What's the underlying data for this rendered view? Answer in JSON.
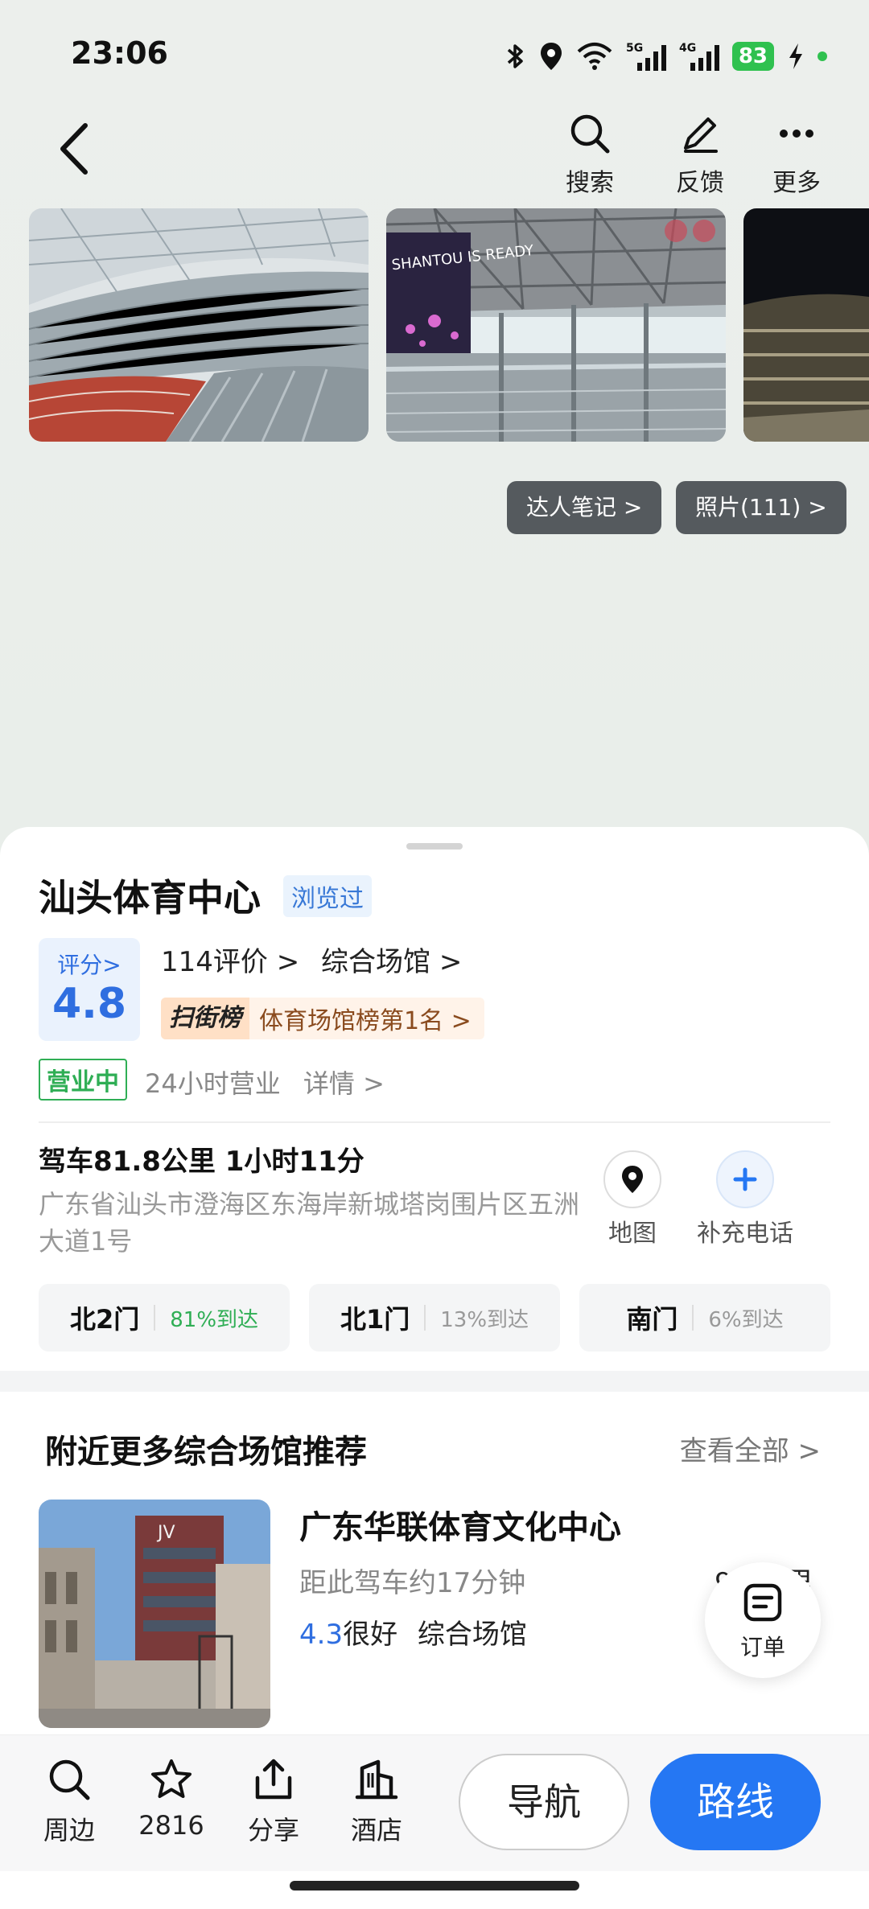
{
  "status_bar": {
    "time": "23:06",
    "battery": "83",
    "network_1": "5G",
    "network_2": "4G"
  },
  "header": {
    "actions": [
      {
        "label": "搜索",
        "icon": "search-icon"
      },
      {
        "label": "反馈",
        "icon": "edit-icon"
      },
      {
        "label": "更多",
        "icon": "more-icon"
      }
    ]
  },
  "gallery": {
    "chips": [
      "达人笔记 >",
      "照片(111) >"
    ],
    "photo2_text": "SHANTOU IS READY"
  },
  "place": {
    "title": "汕头体育中心",
    "browsed": "浏览过",
    "score_label": "评分>",
    "score": "4.8",
    "reviews": "114评价 >",
    "category": "综合场馆 >",
    "rank_tag": "扫街榜",
    "rank_text": "体育场馆榜第1名 >",
    "open_status": "营业中",
    "hours": "24小时营业",
    "details": "详情 >",
    "drive": "驾车81.8公里 1小时11分",
    "address": "广东省汕头市澄海区东海岸新城塔岗围片区五洲大道1号",
    "map_label": "地图",
    "phone_label": "补充电话",
    "gates": [
      {
        "name": "北2门",
        "pct": "81%到达"
      },
      {
        "name": "北1门",
        "pct": "13%到达"
      },
      {
        "name": "南门",
        "pct": "6%到达"
      }
    ]
  },
  "nearby": {
    "title": "附近更多综合场馆推荐",
    "see_all": "查看全部 >",
    "item": {
      "name": "广东华联体育文化中心",
      "time": "距此驾车约17分钟",
      "distance": "9.2公里",
      "rating": "4.3",
      "rating_text": "很好",
      "category": "综合场馆"
    },
    "order_label": "订单"
  },
  "bottom_bar": {
    "items": [
      {
        "label": "周边",
        "icon": "search-icon"
      },
      {
        "label": "2816",
        "icon": "star-icon"
      },
      {
        "label": "分享",
        "icon": "share-icon"
      },
      {
        "label": "酒店",
        "icon": "hotel-icon"
      }
    ],
    "nav_label": "导航",
    "route_label": "路线"
  },
  "colors": {
    "accent": "#2577f3",
    "open_green": "#2fae55",
    "rank_brown": "#8a4b1e"
  }
}
